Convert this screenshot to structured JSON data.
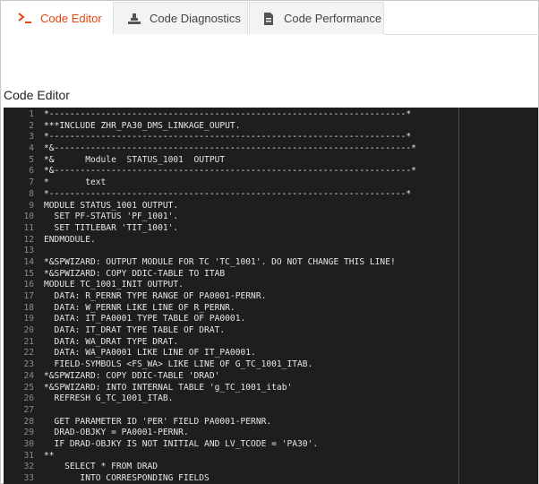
{
  "tabs": [
    {
      "label": "Code Editor",
      "icon": "terminal-icon",
      "active": true
    },
    {
      "label": "Code Diagnostics",
      "icon": "diagnostics-icon",
      "active": false
    },
    {
      "label": "Code Performance",
      "icon": "document-icon",
      "active": false
    }
  ],
  "section_title": "Code Editor",
  "colors": {
    "accent": "#e2450f",
    "editor_bg": "#1e1e1e",
    "code_text": "#e6e6e6",
    "line_number": "#8a8a8a"
  },
  "code_lines": [
    "*---------------------------------------------------------------------*",
    "***INCLUDE ZHR_PA30_DMS_LINKAGE_OUPUT.",
    "*---------------------------------------------------------------------*",
    "*&---------------------------------------------------------------------*",
    "*&      Module  STATUS_1001  OUTPUT",
    "*&---------------------------------------------------------------------*",
    "*       text",
    "*---------------------------------------------------------------------*",
    "MODULE STATUS_1001 OUTPUT.",
    "  SET PF-STATUS 'PF_1001'.",
    "  SET TITLEBAR 'TIT_1001'.",
    "ENDMODULE.",
    "",
    "*&SPWIZARD: OUTPUT MODULE FOR TC 'TC_1001'. DO NOT CHANGE THIS LINE!",
    "*&SPWIZARD: COPY DDIC-TABLE TO ITAB",
    "MODULE TC_1001_INIT OUTPUT.",
    "  DATA: R_PERNR TYPE RANGE OF PA0001-PERNR.",
    "  DATA: W_PERNR LIKE LINE OF R_PERNR.",
    "  DATA: IT_PA0001 TYPE TABLE OF PA0001.",
    "  DATA: IT_DRAT TYPE TABLE OF DRAT.",
    "  DATA: WA_DRAT TYPE DRAT.",
    "  DATA: WA_PA0001 LIKE LINE OF IT_PA0001.",
    "  FIELD-SYMBOLS <FS_WA> LIKE LINE OF G_TC_1001_ITAB.",
    "*&SPWIZARD: COPY DDIC-TABLE 'DRAD'",
    "*&SPWIZARD: INTO INTERNAL TABLE 'g_TC_1001_itab'",
    "  REFRESH G_TC_1001_ITAB.",
    "",
    "  GET PARAMETER ID 'PER' FIELD PA0001-PERNR.",
    "  DRAD-OBJKY = PA0001-PERNR.",
    "  IF DRAD-OBJKY IS NOT INITIAL AND LV_TCODE = 'PA30'.",
    "**",
    "    SELECT * FROM DRAD",
    "       INTO CORRESPONDING FIELDS"
  ]
}
